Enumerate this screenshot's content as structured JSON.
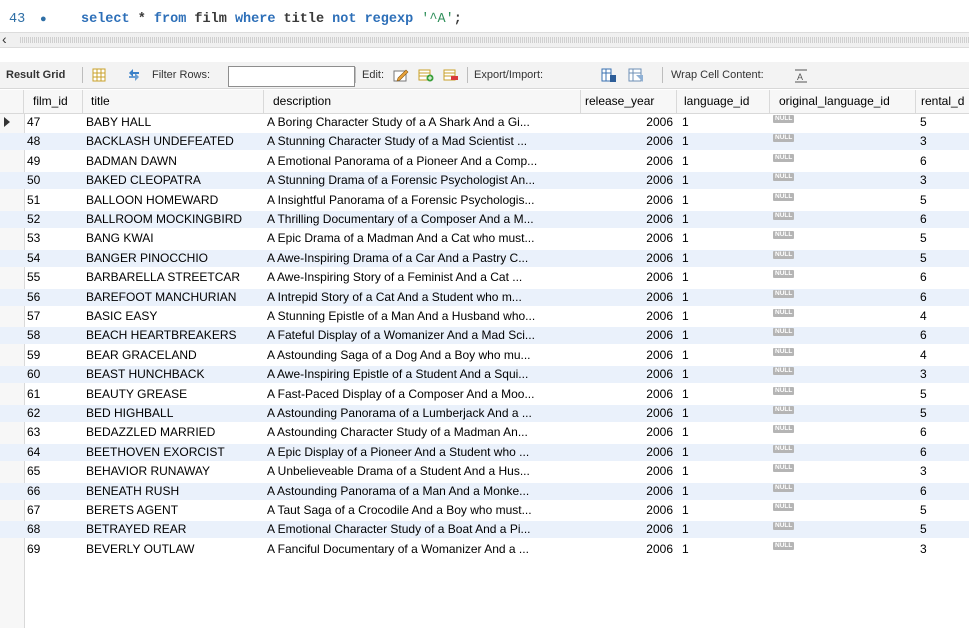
{
  "editor": {
    "line_number": "43",
    "query_keyword_select": "select",
    "query_star": " * ",
    "query_keyword_from": "from",
    "query_table": " film ",
    "query_keyword_where": "where",
    "query_column": " title ",
    "query_keyword_not": "not",
    "query_keyword_regexp": " regexp ",
    "query_string": "'^A'",
    "query_end": ";"
  },
  "toolbar": {
    "result_grid_label": "Result Grid",
    "filter_rows_label": "Filter Rows:",
    "filter_rows_value": "",
    "edit_label": "Edit:",
    "export_import_label": "Export/Import:",
    "wrap_cell_label": "Wrap Cell Content:"
  },
  "columns": [
    "film_id",
    "title",
    "description",
    "release_year",
    "language_id",
    "original_language_id",
    "rental_d"
  ],
  "null_label": "NULL",
  "rows": [
    {
      "film_id": "47",
      "title": "BABY HALL",
      "description": "A Boring Character Study of a A Shark And a Gi...",
      "release_year": "2006",
      "language_id": "1",
      "rental": "5"
    },
    {
      "film_id": "48",
      "title": "BACKLASH UNDEFEATED",
      "description": "A Stunning Character Study of a Mad Scientist ...",
      "release_year": "2006",
      "language_id": "1",
      "rental": "3"
    },
    {
      "film_id": "49",
      "title": "BADMAN DAWN",
      "description": "A Emotional Panorama of a Pioneer And a Comp...",
      "release_year": "2006",
      "language_id": "1",
      "rental": "6"
    },
    {
      "film_id": "50",
      "title": "BAKED CLEOPATRA",
      "description": "A Stunning Drama of a Forensic Psychologist An...",
      "release_year": "2006",
      "language_id": "1",
      "rental": "3"
    },
    {
      "film_id": "51",
      "title": "BALLOON HOMEWARD",
      "description": "A Insightful Panorama of a Forensic Psychologis...",
      "release_year": "2006",
      "language_id": "1",
      "rental": "5"
    },
    {
      "film_id": "52",
      "title": "BALLROOM MOCKINGBIRD",
      "description": "A Thrilling Documentary of a Composer And a M...",
      "release_year": "2006",
      "language_id": "1",
      "rental": "6"
    },
    {
      "film_id": "53",
      "title": "BANG KWAI",
      "description": "A Epic Drama of a Madman And a Cat who must...",
      "release_year": "2006",
      "language_id": "1",
      "rental": "5"
    },
    {
      "film_id": "54",
      "title": "BANGER PINOCCHIO",
      "description": "A Awe-Inspiring Drama of a Car And a Pastry C...",
      "release_year": "2006",
      "language_id": "1",
      "rental": "5"
    },
    {
      "film_id": "55",
      "title": "BARBARELLA STREETCAR",
      "description": "A Awe-Inspiring Story of a Feminist And a Cat ...",
      "release_year": "2006",
      "language_id": "1",
      "rental": "6"
    },
    {
      "film_id": "56",
      "title": "BAREFOOT MANCHURIAN",
      "description": "A Intrepid Story of a Cat And a Student who m...",
      "release_year": "2006",
      "language_id": "1",
      "rental": "6"
    },
    {
      "film_id": "57",
      "title": "BASIC EASY",
      "description": "A Stunning Epistle of a Man And a Husband who...",
      "release_year": "2006",
      "language_id": "1",
      "rental": "4"
    },
    {
      "film_id": "58",
      "title": "BEACH HEARTBREAKERS",
      "description": "A Fateful Display of a Womanizer And a Mad Sci...",
      "release_year": "2006",
      "language_id": "1",
      "rental": "6"
    },
    {
      "film_id": "59",
      "title": "BEAR GRACELAND",
      "description": "A Astounding Saga of a Dog And a Boy who mu...",
      "release_year": "2006",
      "language_id": "1",
      "rental": "4"
    },
    {
      "film_id": "60",
      "title": "BEAST HUNCHBACK",
      "description": "A Awe-Inspiring Epistle of a Student And a Squi...",
      "release_year": "2006",
      "language_id": "1",
      "rental": "3"
    },
    {
      "film_id": "61",
      "title": "BEAUTY GREASE",
      "description": "A Fast-Paced Display of a Composer And a Moo...",
      "release_year": "2006",
      "language_id": "1",
      "rental": "5"
    },
    {
      "film_id": "62",
      "title": "BED HIGHBALL",
      "description": "A Astounding Panorama of a Lumberjack And a ...",
      "release_year": "2006",
      "language_id": "1",
      "rental": "5"
    },
    {
      "film_id": "63",
      "title": "BEDAZZLED MARRIED",
      "description": "A Astounding Character Study of a Madman An...",
      "release_year": "2006",
      "language_id": "1",
      "rental": "6"
    },
    {
      "film_id": "64",
      "title": "BEETHOVEN EXORCIST",
      "description": "A Epic Display of a Pioneer And a Student who ...",
      "release_year": "2006",
      "language_id": "1",
      "rental": "6"
    },
    {
      "film_id": "65",
      "title": "BEHAVIOR RUNAWAY",
      "description": "A Unbelieveable Drama of a Student And a Hus...",
      "release_year": "2006",
      "language_id": "1",
      "rental": "3"
    },
    {
      "film_id": "66",
      "title": "BENEATH RUSH",
      "description": "A Astounding Panorama of a Man And a Monke...",
      "release_year": "2006",
      "language_id": "1",
      "rental": "6"
    },
    {
      "film_id": "67",
      "title": "BERETS AGENT",
      "description": "A Taut Saga of a Crocodile And a Boy who must...",
      "release_year": "2006",
      "language_id": "1",
      "rental": "5"
    },
    {
      "film_id": "68",
      "title": "BETRAYED REAR",
      "description": "A Emotional Character Study of a Boat And a Pi...",
      "release_year": "2006",
      "language_id": "1",
      "rental": "5"
    },
    {
      "film_id": "69",
      "title": "BEVERLY OUTLAW",
      "description": "A Fanciful Documentary of a Womanizer And a ...",
      "release_year": "2006",
      "language_id": "1",
      "rental": "3"
    }
  ]
}
